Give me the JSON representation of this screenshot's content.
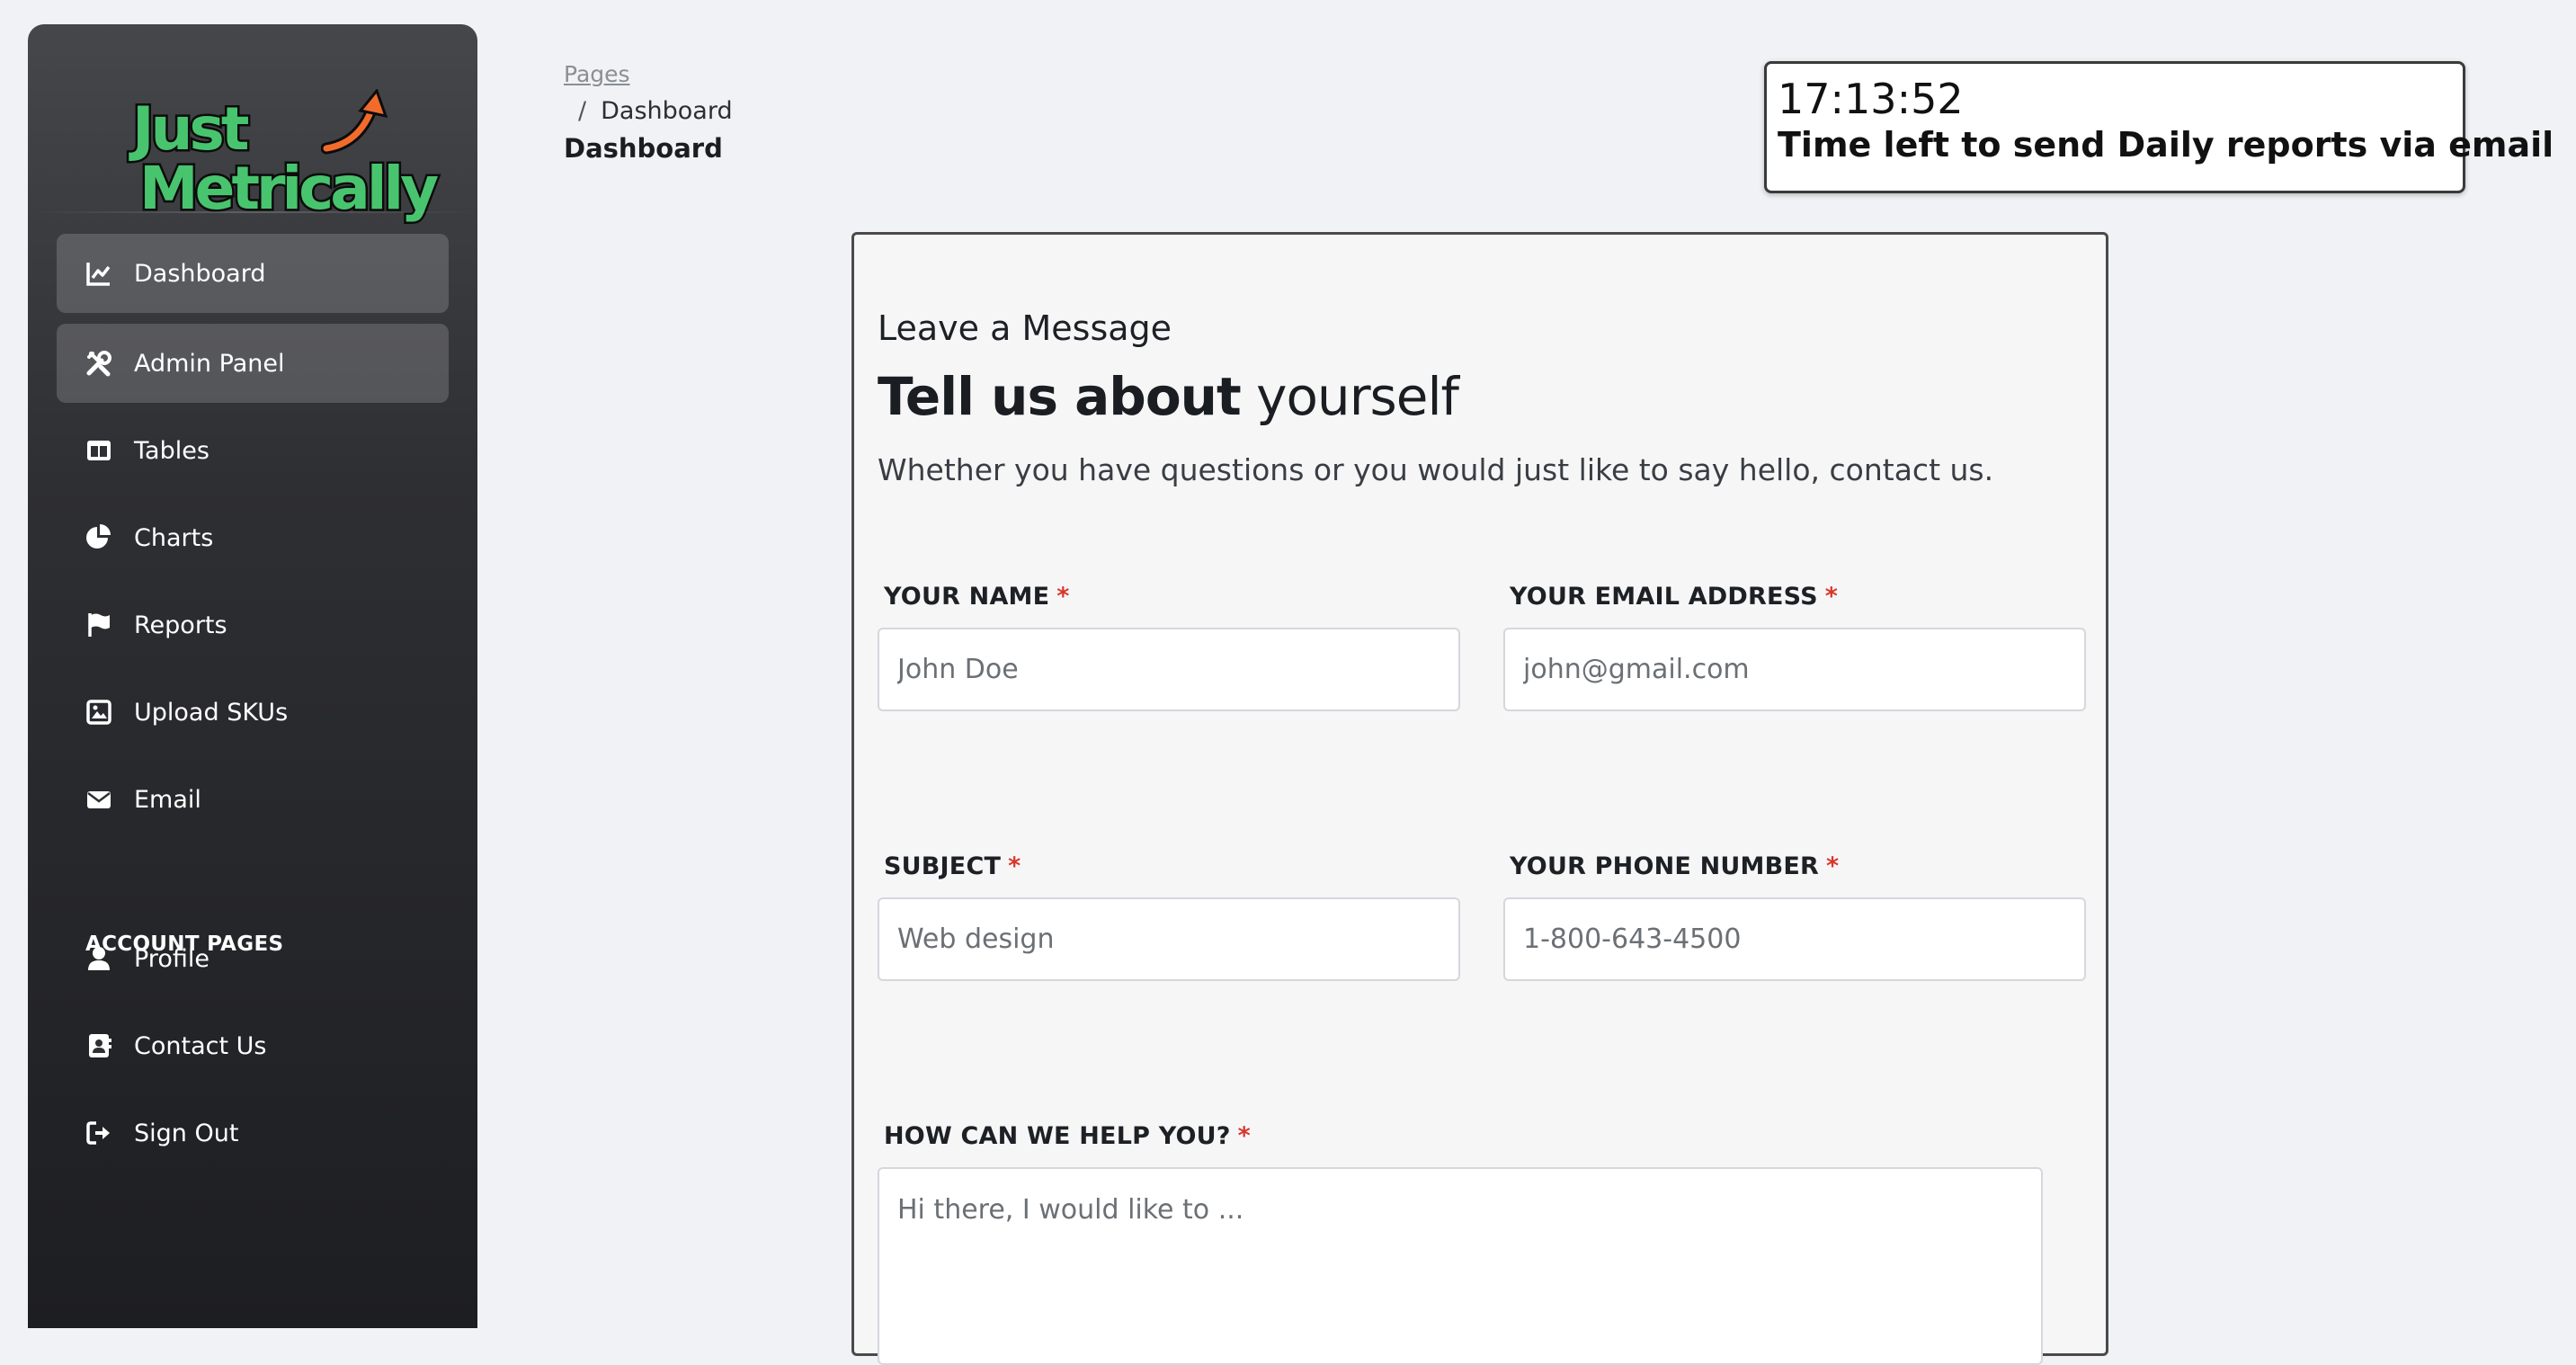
{
  "brand": {
    "logo_line1": "Just",
    "logo_line2": "Metrically",
    "logo_arrow_color": "#f26b2b",
    "logo_green": "#48c46e"
  },
  "sidebar": {
    "items": [
      {
        "label": "Dashboard",
        "icon": "chart-line-icon",
        "active": true
      },
      {
        "label": "Admin Panel",
        "icon": "tools-icon",
        "active": true
      },
      {
        "label": "Tables",
        "icon": "table-icon",
        "active": false
      },
      {
        "label": "Charts",
        "icon": "pie-chart-icon",
        "active": false
      },
      {
        "label": "Reports",
        "icon": "flag-icon",
        "active": false
      },
      {
        "label": "Upload SKUs",
        "icon": "image-icon",
        "active": false
      },
      {
        "label": "Email",
        "icon": "envelope-icon",
        "active": false
      }
    ],
    "section_title": "ACCOUNT PAGES",
    "account_items": [
      {
        "label": "Profile",
        "icon": "user-icon"
      },
      {
        "label": "Contact Us",
        "icon": "address-book-icon"
      },
      {
        "label": "Sign Out",
        "icon": "sign-out-icon"
      }
    ]
  },
  "header": {
    "breadcrumb_root": "Pages",
    "breadcrumb_separator": "/",
    "breadcrumb_current": "Dashboard",
    "page_title": "Dashboard"
  },
  "timer": {
    "time": "17:13:52",
    "label": "Time left to send Daily reports via email"
  },
  "form": {
    "kicker": "Leave a Message",
    "headline_bold": "Tell us about",
    "headline_light": "yourself",
    "lead": "Whether you have questions or you would just like to say hello, contact us.",
    "required_mark": "*",
    "fields": {
      "name": {
        "label": "YOUR NAME",
        "placeholder": "John Doe"
      },
      "email": {
        "label": "YOUR EMAIL ADDRESS",
        "placeholder": "john@gmail.com"
      },
      "subject": {
        "label": "SUBJECT",
        "placeholder": "Web design"
      },
      "phone": {
        "label": "YOUR PHONE NUMBER",
        "placeholder": "1-800-643-4500"
      },
      "message": {
        "label": "HOW CAN WE HELP YOU?",
        "placeholder": "Hi there, I would like to ..."
      }
    }
  }
}
